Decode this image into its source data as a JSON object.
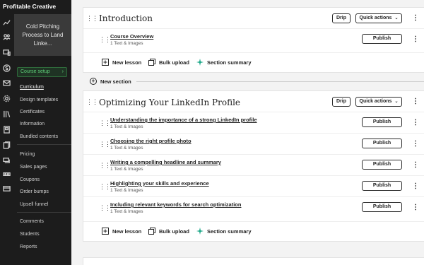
{
  "brand": "Profitable Creative",
  "course_card": {
    "title": "Cold Pitching Process to Land Linke..."
  },
  "sidebar": {
    "setup_label": "Course setup",
    "course_menu": [
      {
        "label": "Curriculum",
        "active": true
      },
      {
        "label": "Design templates"
      },
      {
        "label": "Certificates"
      },
      {
        "label": "Information"
      },
      {
        "label": "Bundled contents"
      }
    ],
    "sales_menu": [
      {
        "label": "Pricing"
      },
      {
        "label": "Sales pages"
      },
      {
        "label": "Coupons"
      },
      {
        "label": "Order bumps"
      },
      {
        "label": "Upsell funnel"
      }
    ],
    "community_menu": [
      {
        "label": "Comments"
      },
      {
        "label": "Students"
      },
      {
        "label": "Reports"
      }
    ],
    "rail_icons": [
      "analytics-icon",
      "users-icon",
      "devices-icon",
      "dollar-icon",
      "mail-icon",
      "settings-icon",
      "library-icon",
      "page-icon",
      "pages-icon",
      "chat-icon",
      "ticket-icon",
      "card-icon"
    ]
  },
  "sections": [
    {
      "title": "Introduction",
      "drip_label": "Drip",
      "quick_actions_label": "Quick actions",
      "lessons": [
        {
          "title": "Course Overview",
          "meta": "1 Text & Images",
          "publish_label": "Publish"
        }
      ]
    },
    {
      "title": "Optimizing Your LinkedIn Profile",
      "drip_label": "Drip",
      "quick_actions_label": "Quick actions",
      "lessons": [
        {
          "title": "Understanding the importance of a strong LinkedIn profile",
          "meta": "1 Text & Images",
          "publish_label": "Publish"
        },
        {
          "title": "Choosing the right profile photo",
          "meta": "1 Text & Images",
          "publish_label": "Publish"
        },
        {
          "title": "Writing a compelling headline and summary",
          "meta": "1 Text & Images",
          "publish_label": "Publish"
        },
        {
          "title": "Highlighting your skills and experience",
          "meta": "1 Text & Images",
          "publish_label": "Publish"
        },
        {
          "title": "Including relevant keywords for search optimization",
          "meta": "1 Text & Images",
          "publish_label": "Publish"
        }
      ]
    }
  ],
  "actions": {
    "new_lesson": "New lesson",
    "bulk_upload": "Bulk upload",
    "section_summary": "Section summary"
  },
  "new_section_label": "New section",
  "colors": {
    "sidebar_bg": "#1c1c1c",
    "accent_green": "#5fcf79",
    "sparkle_teal": "#1fa98a"
  }
}
